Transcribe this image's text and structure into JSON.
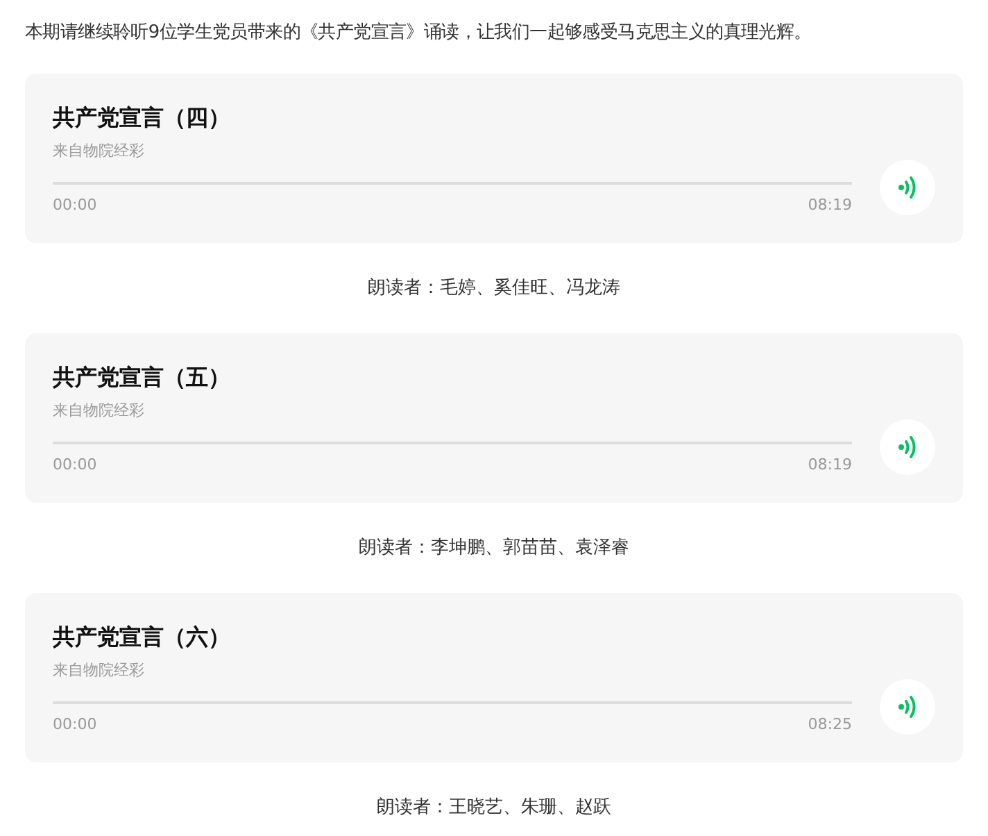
{
  "intro": "本期请继续聆听9位学生党员带来的《共产党宣言》诵读，让我们一起够感受马克思主义的真理光辉。",
  "tracks": [
    {
      "title": "共产党宣言（四）",
      "source": "来自物院经彩",
      "current": "00:00",
      "duration": "08:19",
      "readers": "朗读者：毛婷、奚佳旺、冯龙涛"
    },
    {
      "title": "共产党宣言（五）",
      "source": "来自物院经彩",
      "current": "00:00",
      "duration": "08:19",
      "readers": "朗读者：李坤鹏、郭苗苗、袁泽睿"
    },
    {
      "title": "共产党宣言（六）",
      "source": "来自物院经彩",
      "current": "00:00",
      "duration": "08:25",
      "readers": "朗读者：王晓艺、朱珊、赵跃"
    }
  ]
}
